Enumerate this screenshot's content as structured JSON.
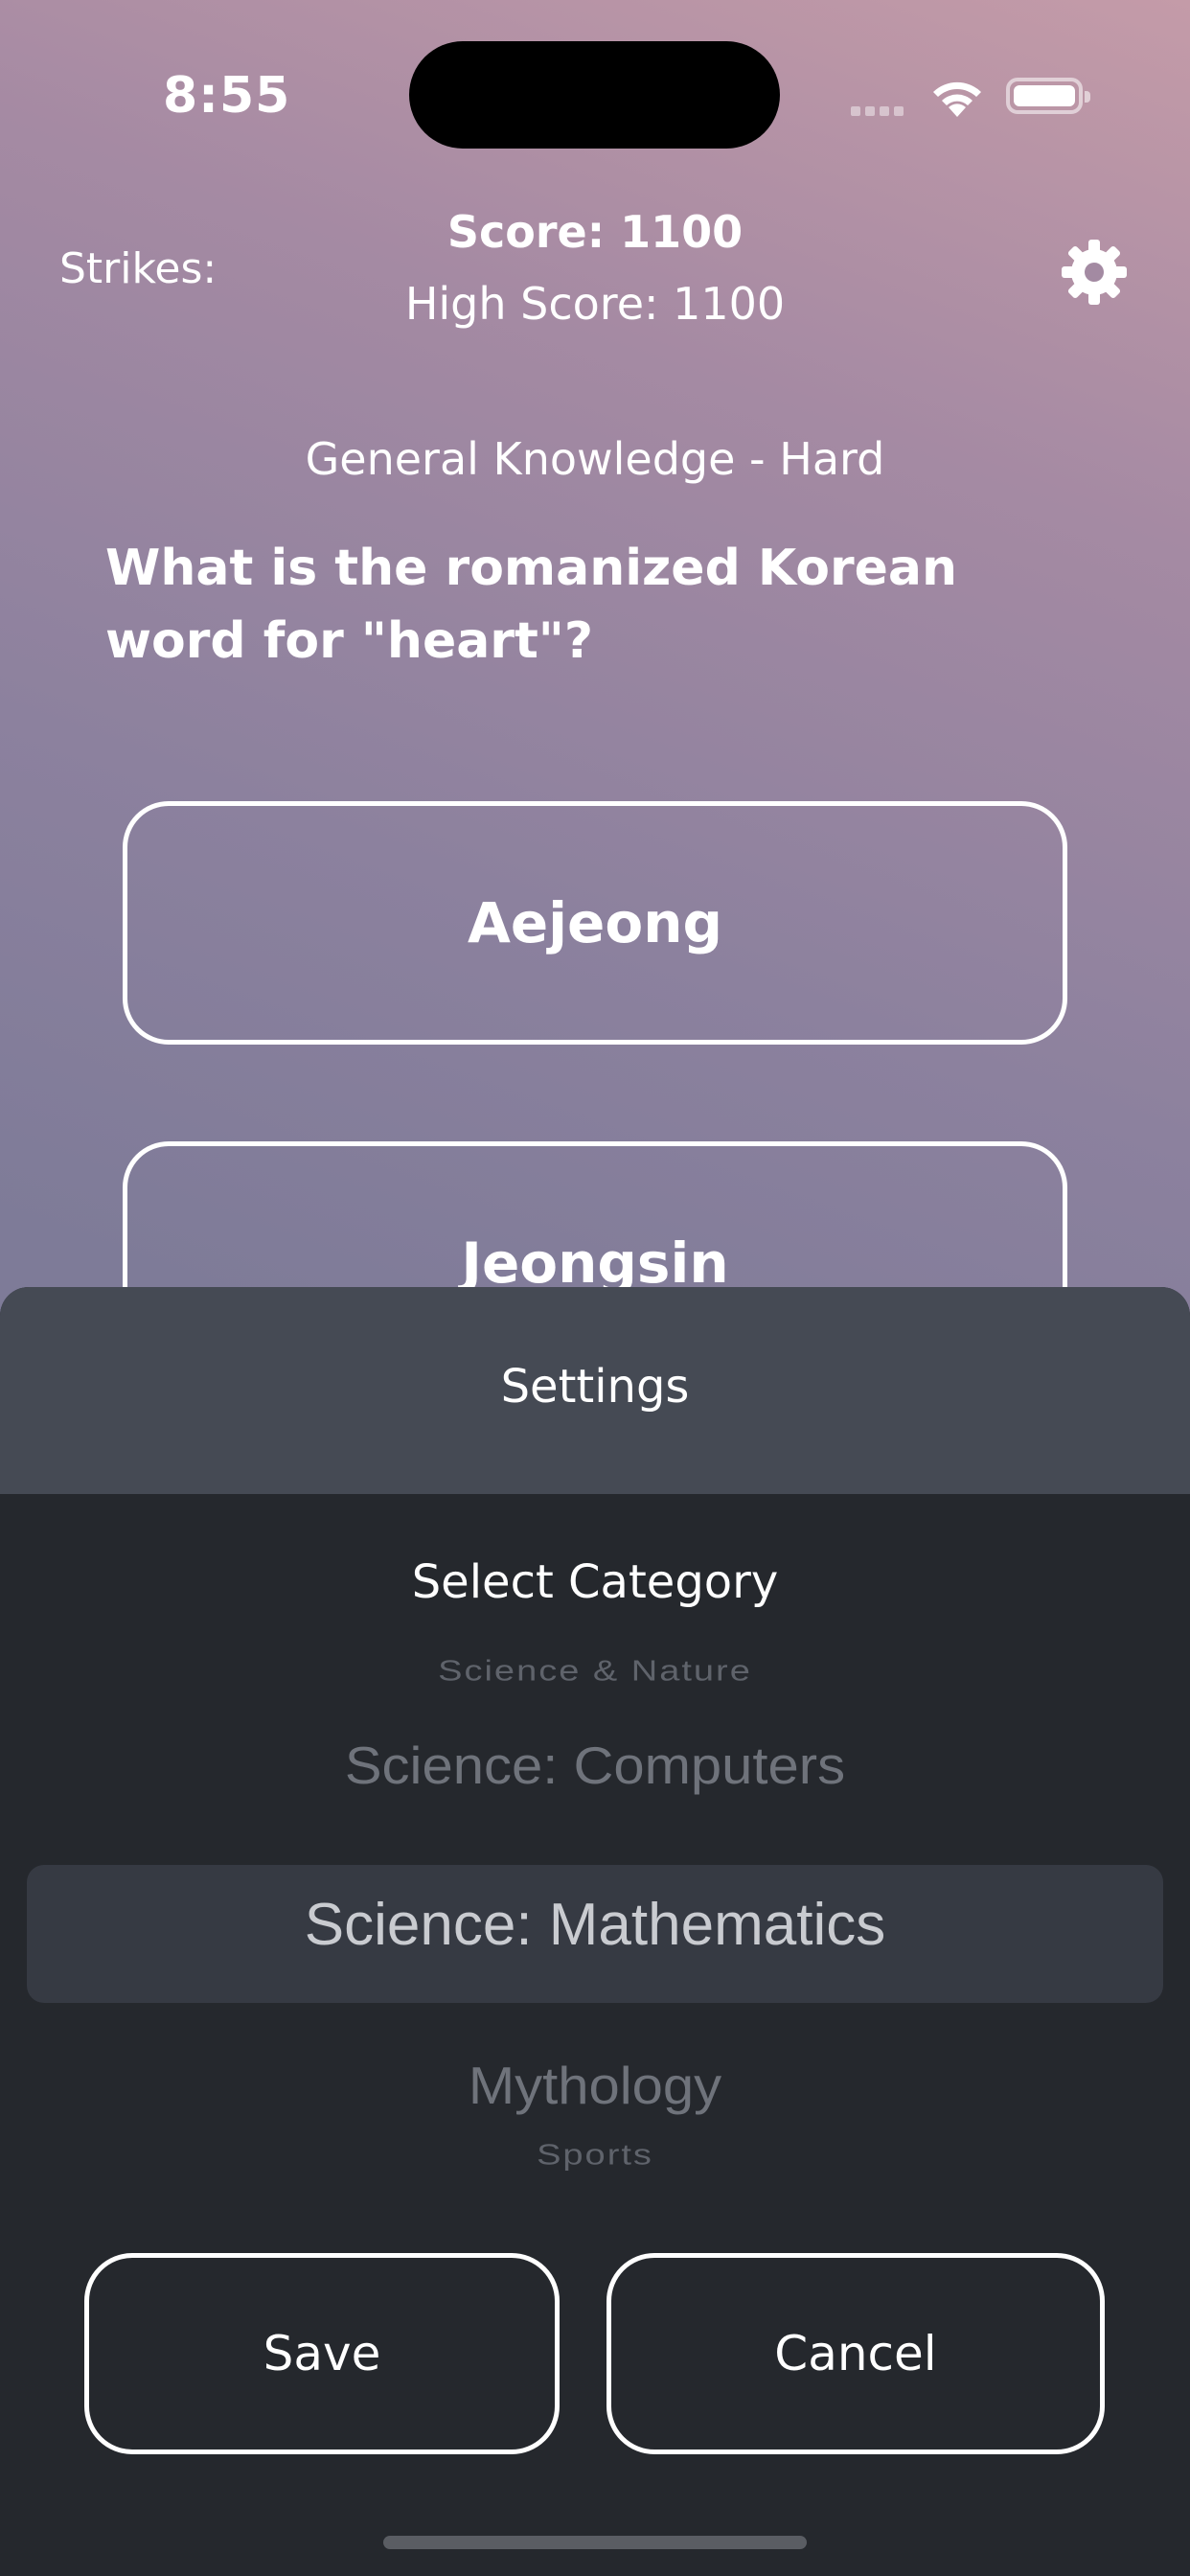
{
  "status_bar": {
    "time": "8:55"
  },
  "header": {
    "strikes_label": "Strikes:",
    "score": "Score: 1100",
    "high_score": "High Score: 1100"
  },
  "question": {
    "category": "General Knowledge - Hard",
    "text": "What is the romanized Korean word for \"heart\"?"
  },
  "answers": [
    {
      "label": "Aejeong"
    },
    {
      "label": "Jeongsin"
    }
  ],
  "settings": {
    "title": "Settings",
    "select_label": "Select Category",
    "options": [
      "Science & Nature",
      "Science: Computers",
      "Science: Mathematics",
      "Mythology",
      "Sports"
    ],
    "selected": "Science: Mathematics",
    "save_label": "Save",
    "cancel_label": "Cancel"
  }
}
